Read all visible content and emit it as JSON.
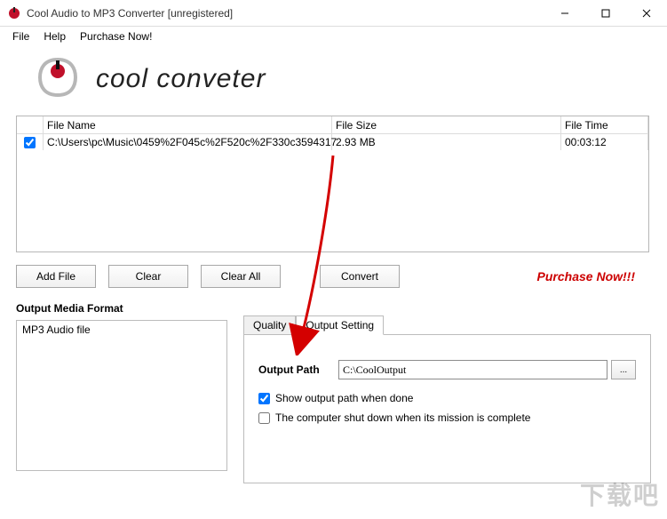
{
  "window": {
    "title": "Cool Audio to MP3 Converter  [unregistered]"
  },
  "menu": {
    "file": "File",
    "help": "Help",
    "purchase": "Purchase Now!"
  },
  "logo_text": "cool conveter",
  "file_table": {
    "col_filename": "File Name",
    "col_filesize": "File Size",
    "col_filetime": "File Time",
    "rows": [
      {
        "checked": true,
        "name": "C:\\Users\\pc\\Music\\0459%2F045c%2F520c%2F330c3594317",
        "size": "2.93 MB",
        "time": "00:03:12"
      }
    ]
  },
  "buttons": {
    "addfile": "Add File",
    "clear": "Clear",
    "clearall": "Clear All",
    "convert": "Convert"
  },
  "purchase_now": "Purchase Now!!!",
  "omf": {
    "label": "Output Media Format",
    "items": [
      "MP3 Audio file"
    ]
  },
  "tabs": {
    "quality": "Quality",
    "output": "Output Setting"
  },
  "output_setting": {
    "output_path_label": "Output Path",
    "output_path_value": "C:\\CoolOutput",
    "browse": "...",
    "show_when_done": "Show output path when done",
    "show_when_done_checked": true,
    "shutdown": "The computer shut down when its mission is complete",
    "shutdown_checked": false
  },
  "watermark": "下载吧"
}
